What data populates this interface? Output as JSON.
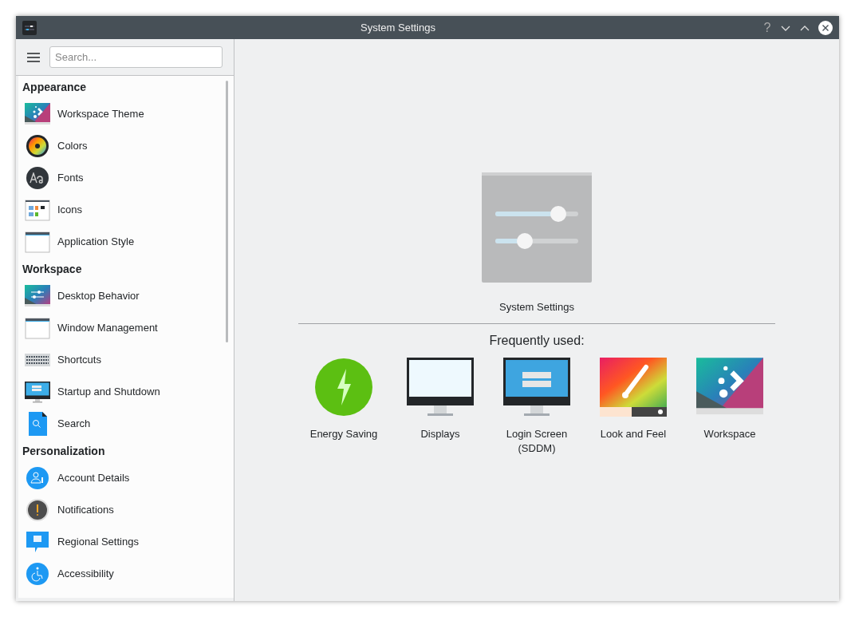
{
  "window": {
    "title": "System Settings",
    "help_button": "?"
  },
  "search": {
    "placeholder": "Search..."
  },
  "sidebar": {
    "sections": [
      {
        "title": "Appearance",
        "items": [
          {
            "label": "Workspace Theme",
            "selected": false
          },
          {
            "label": "Colors",
            "selected": false
          },
          {
            "label": "Fonts",
            "selected": false
          },
          {
            "label": "Icons",
            "selected": false
          },
          {
            "label": "Application Style",
            "selected": false
          }
        ]
      },
      {
        "title": "Workspace",
        "items": [
          {
            "label": "Desktop Behavior",
            "selected": false
          },
          {
            "label": "Window Management",
            "selected": false
          },
          {
            "label": "Shortcuts",
            "selected": false
          },
          {
            "label": "Startup and Shutdown",
            "selected": false
          },
          {
            "label": "Search",
            "selected": false
          }
        ]
      },
      {
        "title": "Personalization",
        "items": [
          {
            "label": "Account Details",
            "selected": false
          },
          {
            "label": "Notifications",
            "selected": false
          },
          {
            "label": "Regional Settings",
            "selected": false
          },
          {
            "label": "Accessibility",
            "selected": false
          }
        ]
      }
    ]
  },
  "hero": {
    "caption": "System Settings"
  },
  "frequently_used": {
    "heading": "Frequently used:",
    "items": [
      {
        "label": "Energy Saving"
      },
      {
        "label": "Displays"
      },
      {
        "label": "Login Screen (SDDM)"
      },
      {
        "label": "Look and Feel"
      },
      {
        "label": "Workspace"
      }
    ]
  }
}
